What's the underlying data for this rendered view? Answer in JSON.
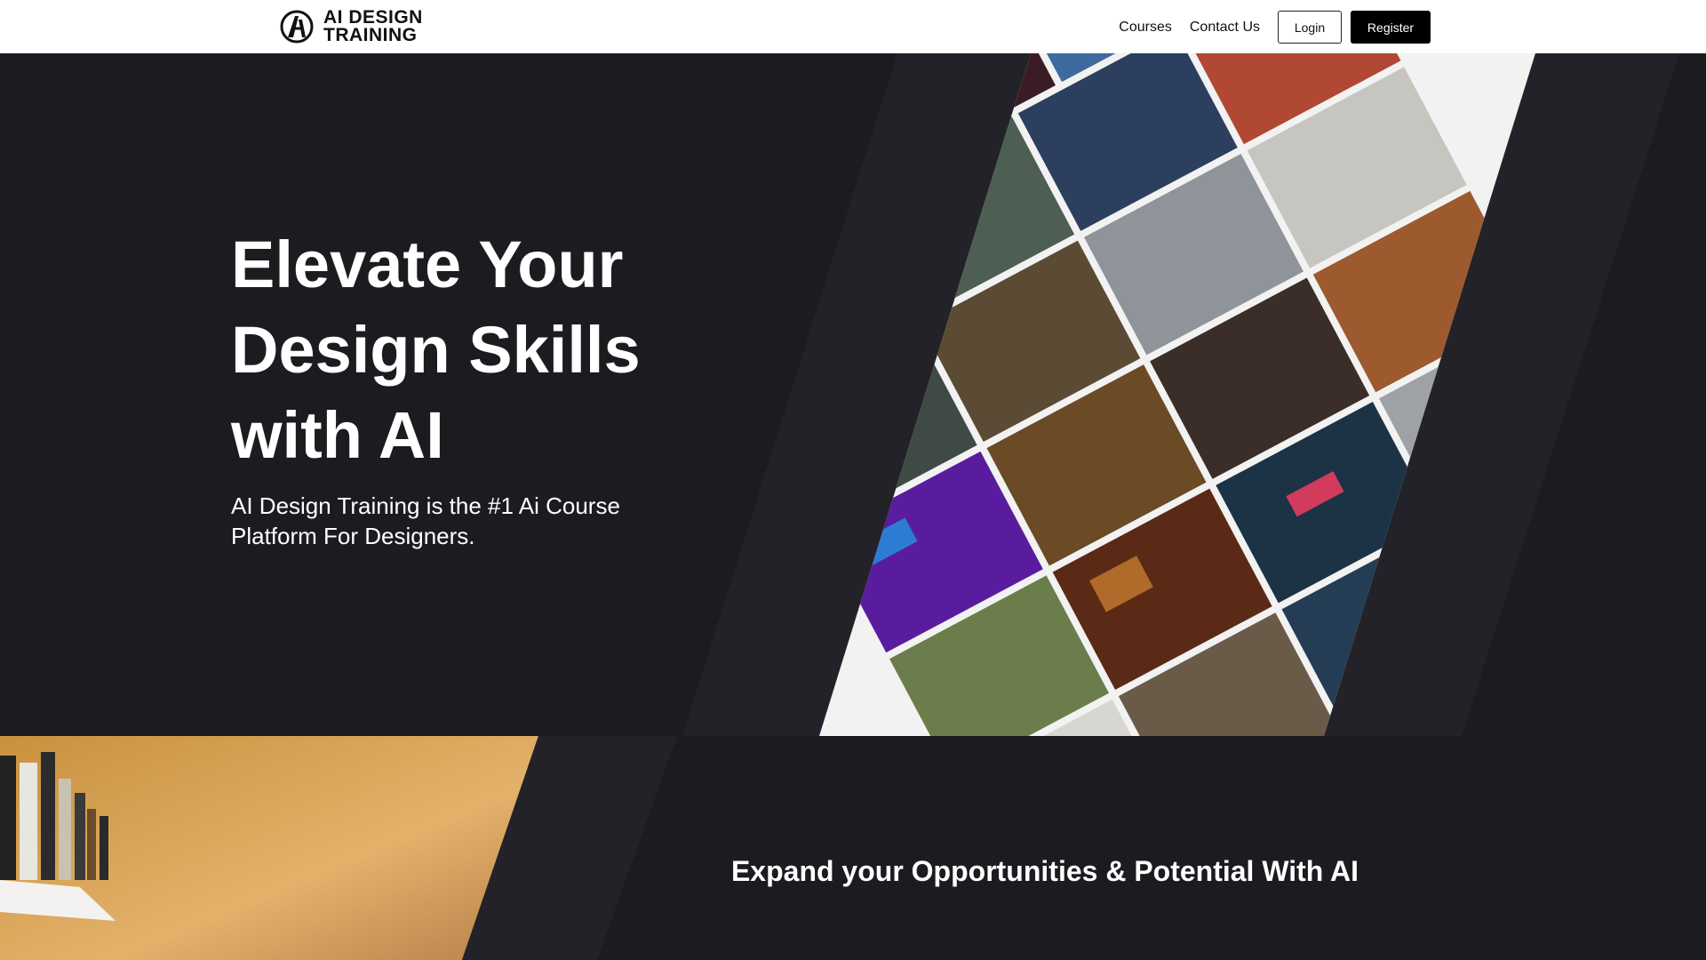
{
  "brand": {
    "name_line1": "AI DESIGN",
    "name_line2": "TRAINING",
    "logo_icon": "ai-design-logo-icon"
  },
  "nav": {
    "courses": "Courses",
    "contact": "Contact Us",
    "login": "Login",
    "register": "Register"
  },
  "hero": {
    "title": "Elevate Your Design Skills with AI",
    "subtitle": "AI Design Training is the #1 Ai Course Platform For Designers."
  },
  "section2": {
    "title": "Expand your Opportunities & Potential With AI"
  },
  "colors": {
    "background": "#1c1b20",
    "stripe": "#232228",
    "header": "#ffffff",
    "accent_black": "#000000"
  }
}
